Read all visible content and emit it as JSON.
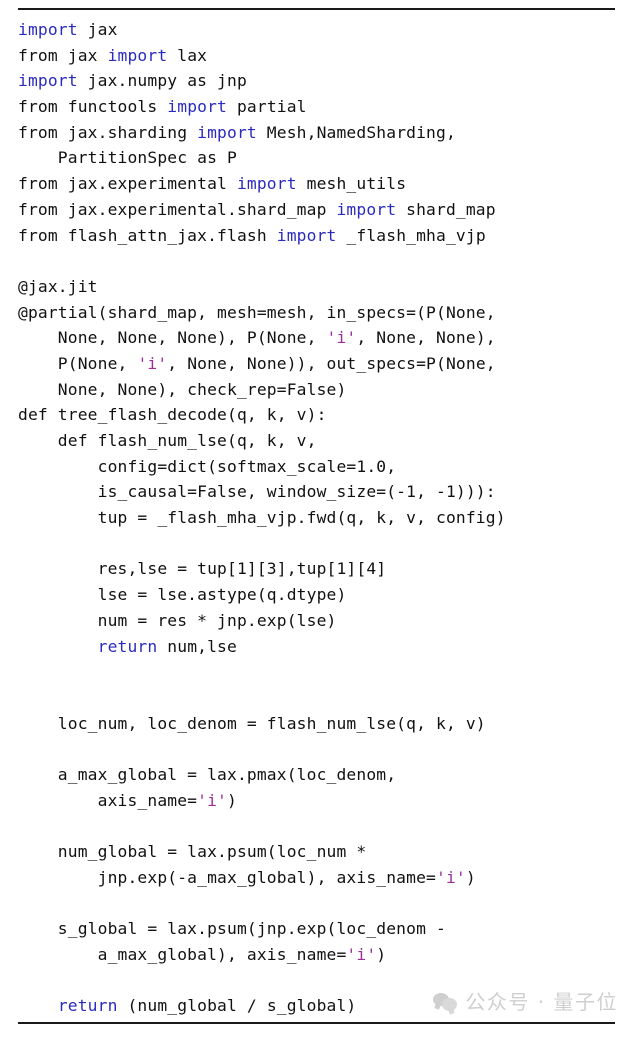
{
  "document": {
    "kind": "code-listing",
    "language": "python",
    "colors": {
      "background": "#ffffff",
      "text": "#111111",
      "keyword": "#2b2bbf",
      "string": "#9c2f9c",
      "rule": "#1a1a1a",
      "watermark": "#cfcfcf"
    }
  },
  "rules": {
    "top": "",
    "bottom": ""
  },
  "code": {
    "lines": [
      [
        {
          "t": "import",
          "c": "kw"
        },
        {
          "t": " jax",
          "c": "plain"
        }
      ],
      [
        {
          "t": "from jax ",
          "c": "plain"
        },
        {
          "t": "import",
          "c": "kw"
        },
        {
          "t": " lax",
          "c": "plain"
        }
      ],
      [
        {
          "t": "import",
          "c": "kw"
        },
        {
          "t": " jax.numpy as jnp",
          "c": "plain"
        }
      ],
      [
        {
          "t": "from functools ",
          "c": "plain"
        },
        {
          "t": "import",
          "c": "kw"
        },
        {
          "t": " partial",
          "c": "plain"
        }
      ],
      [
        {
          "t": "from jax.sharding ",
          "c": "plain"
        },
        {
          "t": "import",
          "c": "kw"
        },
        {
          "t": " Mesh,NamedSharding,",
          "c": "plain"
        }
      ],
      [
        {
          "t": "    PartitionSpec as P",
          "c": "plain"
        }
      ],
      [
        {
          "t": "from jax.experimental ",
          "c": "plain"
        },
        {
          "t": "import",
          "c": "kw"
        },
        {
          "t": " mesh_utils",
          "c": "plain"
        }
      ],
      [
        {
          "t": "from jax.experimental.shard_map ",
          "c": "plain"
        },
        {
          "t": "import",
          "c": "kw"
        },
        {
          "t": " shard_map",
          "c": "plain"
        }
      ],
      [
        {
          "t": "from flash_attn_jax.flash ",
          "c": "plain"
        },
        {
          "t": "import",
          "c": "kw"
        },
        {
          "t": " _flash_mha_vjp",
          "c": "plain"
        }
      ],
      [],
      [
        {
          "t": "@jax.jit",
          "c": "plain"
        }
      ],
      [
        {
          "t": "@partial(shard_map, mesh=mesh, in_specs=(P(None,",
          "c": "plain"
        }
      ],
      [
        {
          "t": "    None, None, None), P(None, ",
          "c": "plain"
        },
        {
          "t": "'i'",
          "c": "str"
        },
        {
          "t": ", None, None),",
          "c": "plain"
        }
      ],
      [
        {
          "t": "    P(None, ",
          "c": "plain"
        },
        {
          "t": "'i'",
          "c": "str"
        },
        {
          "t": ", None, None)), out_specs=P(None,",
          "c": "plain"
        }
      ],
      [
        {
          "t": "    None, None), check_rep=False)",
          "c": "plain"
        }
      ],
      [
        {
          "t": "def tree_flash_decode(q, k, v):",
          "c": "plain"
        }
      ],
      [
        {
          "t": "    def flash_num_lse(q, k, v,",
          "c": "plain"
        }
      ],
      [
        {
          "t": "        config=dict(softmax_scale=1.0,",
          "c": "plain"
        }
      ],
      [
        {
          "t": "        is_causal=False, window_size=(-1, -1))):",
          "c": "plain"
        }
      ],
      [
        {
          "t": "        tup = _flash_mha_vjp.fwd(q, k, v, config)",
          "c": "plain"
        }
      ],
      [],
      [
        {
          "t": "        res,lse = tup[1][3],tup[1][4]",
          "c": "plain"
        }
      ],
      [
        {
          "t": "        lse = lse.astype(q.dtype)",
          "c": "plain"
        }
      ],
      [
        {
          "t": "        num = res * jnp.exp(lse)",
          "c": "plain"
        }
      ],
      [
        {
          "t": "        ",
          "c": "plain"
        },
        {
          "t": "return",
          "c": "kw"
        },
        {
          "t": " num,lse",
          "c": "plain"
        }
      ],
      [],
      [],
      [
        {
          "t": "    loc_num, loc_denom = flash_num_lse(q, k, v)",
          "c": "plain"
        }
      ],
      [],
      [
        {
          "t": "    a_max_global = lax.pmax(loc_denom,",
          "c": "plain"
        }
      ],
      [
        {
          "t": "        axis_name=",
          "c": "plain"
        },
        {
          "t": "'i'",
          "c": "str"
        },
        {
          "t": ")",
          "c": "plain"
        }
      ],
      [],
      [
        {
          "t": "    num_global = lax.psum(loc_num *",
          "c": "plain"
        }
      ],
      [
        {
          "t": "        jnp.exp(-a_max_global), axis_name=",
          "c": "plain"
        },
        {
          "t": "'i'",
          "c": "str"
        },
        {
          "t": ")",
          "c": "plain"
        }
      ],
      [],
      [
        {
          "t": "    s_global = lax.psum(jnp.exp(loc_denom -",
          "c": "plain"
        }
      ],
      [
        {
          "t": "        a_max_global), axis_name=",
          "c": "plain"
        },
        {
          "t": "'i'",
          "c": "str"
        },
        {
          "t": ")",
          "c": "plain"
        }
      ],
      [],
      [
        {
          "t": "    ",
          "c": "plain"
        },
        {
          "t": "return",
          "c": "kw"
        },
        {
          "t": " (num_global / s_global)",
          "c": "plain"
        }
      ]
    ]
  },
  "watermark": {
    "icon": "wechat-icon",
    "text": "公众号 · 量子位"
  }
}
